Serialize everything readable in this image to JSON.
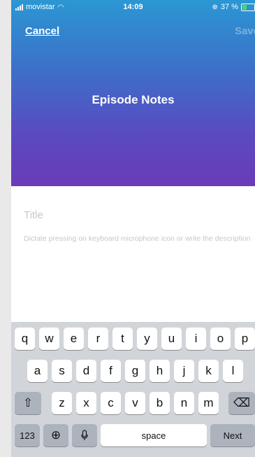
{
  "status_bar": {
    "carrier": "movistar",
    "time": "14:09",
    "battery": "37 %"
  },
  "nav": {
    "cancel_label": "Cancel",
    "save_label": "Save"
  },
  "header": {
    "title": "Episode Notes"
  },
  "form": {
    "title_placeholder": "Title",
    "description_placeholder": "Dictate pressing on keyboard microphone icon or write the description"
  },
  "keyboard": {
    "row1": [
      "q",
      "w",
      "e",
      "r",
      "t",
      "y",
      "u",
      "i",
      "o",
      "p"
    ],
    "row2": [
      "a",
      "s",
      "d",
      "f",
      "g",
      "h",
      "j",
      "k",
      "l"
    ],
    "row3": [
      "z",
      "x",
      "c",
      "v",
      "b",
      "n",
      "m"
    ],
    "numbers_label": "123",
    "space_label": "space",
    "next_label": "Next"
  },
  "colors": {
    "gradient_top": "#2b97d3",
    "gradient_bottom": "#6a3bb8",
    "battery_green": "#4cd964"
  }
}
